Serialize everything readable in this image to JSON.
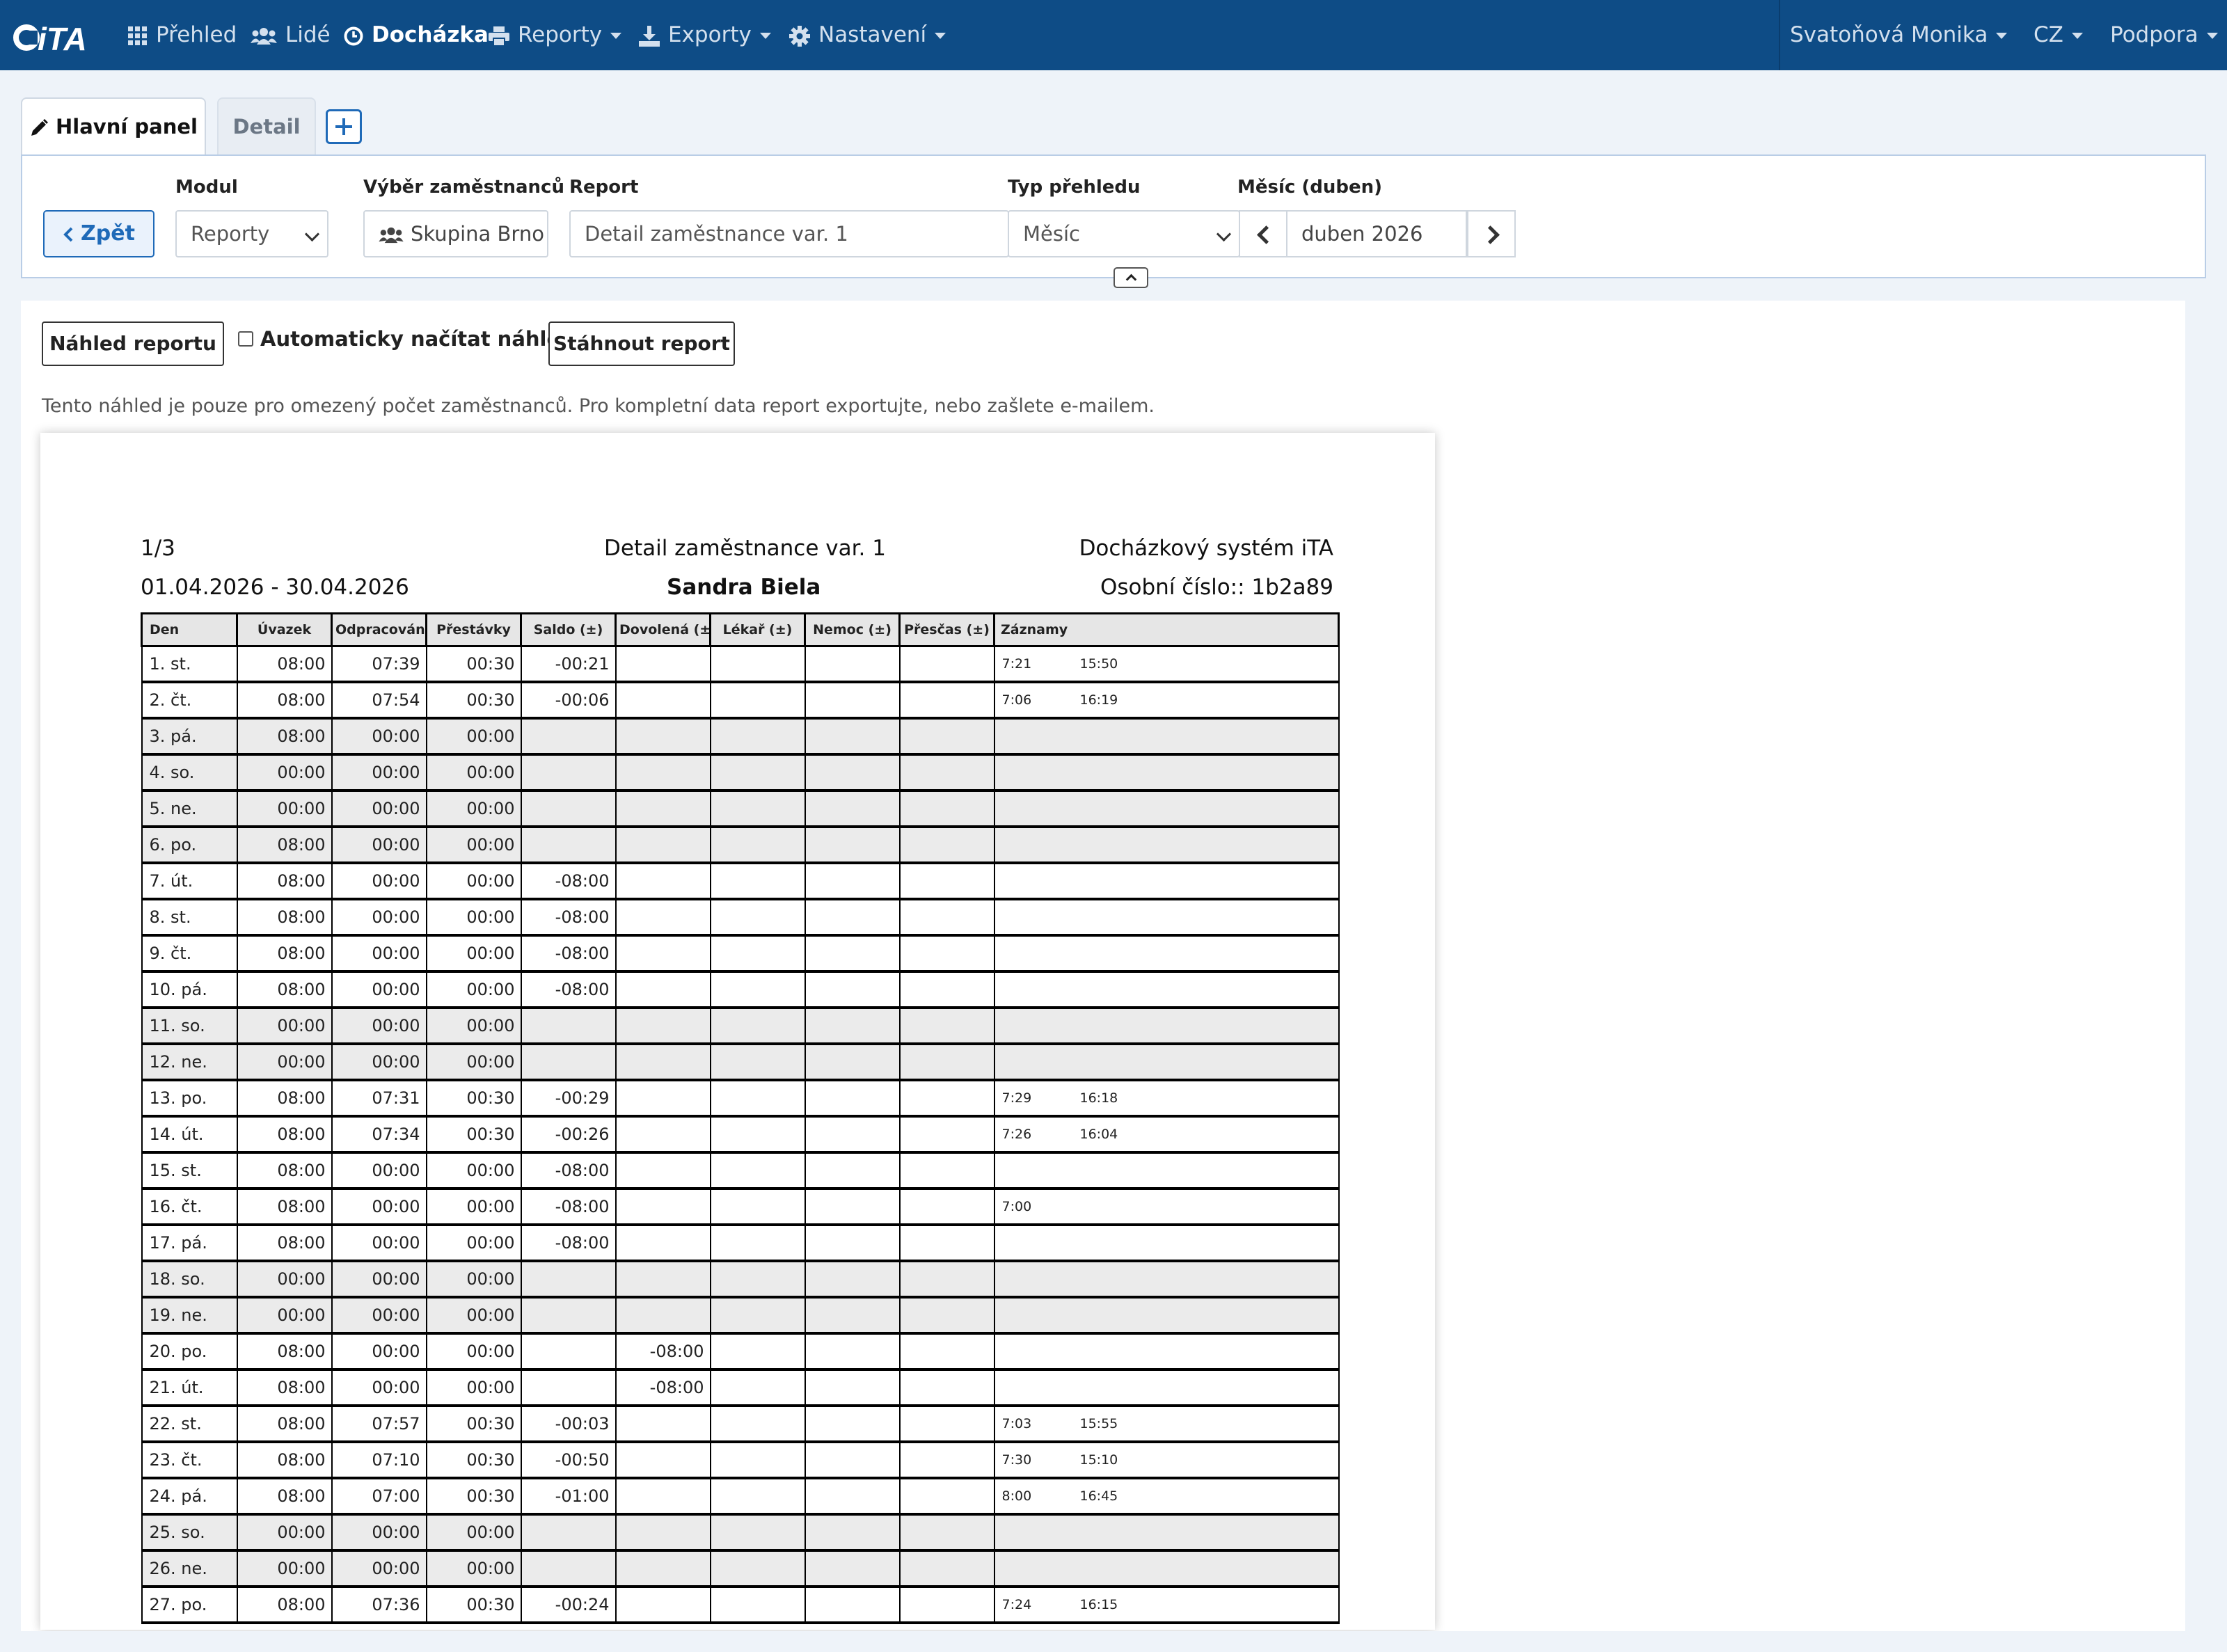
{
  "nav": {
    "logo_text": "iTA",
    "items": [
      {
        "label": "Přehled",
        "icon": "grid-icon"
      },
      {
        "label": "Lidé",
        "icon": "users-icon"
      },
      {
        "label": "Docházka",
        "icon": "clock-icon"
      },
      {
        "label": "Reporty",
        "icon": "print-icon"
      },
      {
        "label": "Exporty",
        "icon": "export-icon"
      },
      {
        "label": "Nastavení",
        "icon": "gear-icon"
      }
    ],
    "user": "Svatoňová Monika",
    "lang": "CZ",
    "support": "Podpora"
  },
  "tabs": {
    "main": "Hlavní panel",
    "detail": "Detail"
  },
  "filters": {
    "back": "Zpět",
    "module_label": "Modul",
    "module_value": "Reporty",
    "employees_label": "Výběr zaměstnanců",
    "employees_value": "Skupina Brno",
    "report_label": "Report",
    "report_value": "Detail zaměstnance var. 1",
    "type_label": "Typ přehledu",
    "type_value": "Měsíc",
    "month_label": "Měsíc (duben)",
    "month_value": "duben 2026"
  },
  "actions": {
    "preview": "Náhled reportu",
    "auto_load": "Automaticky načítat náhled",
    "download": "Stáhnout report",
    "info": "Tento náhled je pouze pro omezený počet zaměstnanců. Pro kompletní data report exportujte, nebo zašlete e-mailem."
  },
  "report": {
    "page": "1/3",
    "title": "Detail zaměstnance var. 1",
    "system": "Docházkový systém iTA",
    "range": "01.04.2026 - 30.04.2026",
    "employee": "Sandra Biela",
    "personal_no": "Osobní číslo:: 1b2a89",
    "columns": [
      "Den",
      "Úvazek",
      "Odpracováno",
      "Přestávky",
      "Saldo (±)",
      "Dovolená (±)",
      "Lékař (±)",
      "Nemoc (±)",
      "Přesčas (±)",
      "Záznamy"
    ],
    "rows": [
      {
        "day": "1. st.",
        "uvazek": "08:00",
        "odprac": "07:39",
        "prest": "00:30",
        "saldo": "-00:21",
        "dovol": "",
        "in": "7:21",
        "out": "15:50",
        "off": false
      },
      {
        "day": "2. čt.",
        "uvazek": "08:00",
        "odprac": "07:54",
        "prest": "00:30",
        "saldo": "-00:06",
        "dovol": "",
        "in": "7:06",
        "out": "16:19",
        "off": false
      },
      {
        "day": "3. pá.",
        "uvazek": "08:00",
        "odprac": "00:00",
        "prest": "00:00",
        "saldo": "",
        "dovol": "",
        "in": "",
        "out": "",
        "off": true
      },
      {
        "day": "4. so.",
        "uvazek": "00:00",
        "odprac": "00:00",
        "prest": "00:00",
        "saldo": "",
        "dovol": "",
        "in": "",
        "out": "",
        "off": true
      },
      {
        "day": "5. ne.",
        "uvazek": "00:00",
        "odprac": "00:00",
        "prest": "00:00",
        "saldo": "",
        "dovol": "",
        "in": "",
        "out": "",
        "off": true
      },
      {
        "day": "6. po.",
        "uvazek": "08:00",
        "odprac": "00:00",
        "prest": "00:00",
        "saldo": "",
        "dovol": "",
        "in": "",
        "out": "",
        "off": true
      },
      {
        "day": "7. út.",
        "uvazek": "08:00",
        "odprac": "00:00",
        "prest": "00:00",
        "saldo": "-08:00",
        "dovol": "",
        "in": "",
        "out": "",
        "off": false
      },
      {
        "day": "8. st.",
        "uvazek": "08:00",
        "odprac": "00:00",
        "prest": "00:00",
        "saldo": "-08:00",
        "dovol": "",
        "in": "",
        "out": "",
        "off": false
      },
      {
        "day": "9. čt.",
        "uvazek": "08:00",
        "odprac": "00:00",
        "prest": "00:00",
        "saldo": "-08:00",
        "dovol": "",
        "in": "",
        "out": "",
        "off": false
      },
      {
        "day": "10. pá.",
        "uvazek": "08:00",
        "odprac": "00:00",
        "prest": "00:00",
        "saldo": "-08:00",
        "dovol": "",
        "in": "",
        "out": "",
        "off": false
      },
      {
        "day": "11. so.",
        "uvazek": "00:00",
        "odprac": "00:00",
        "prest": "00:00",
        "saldo": "",
        "dovol": "",
        "in": "",
        "out": "",
        "off": true
      },
      {
        "day": "12. ne.",
        "uvazek": "00:00",
        "odprac": "00:00",
        "prest": "00:00",
        "saldo": "",
        "dovol": "",
        "in": "",
        "out": "",
        "off": true
      },
      {
        "day": "13. po.",
        "uvazek": "08:00",
        "odprac": "07:31",
        "prest": "00:30",
        "saldo": "-00:29",
        "dovol": "",
        "in": "7:29",
        "out": "16:18",
        "off": false
      },
      {
        "day": "14. út.",
        "uvazek": "08:00",
        "odprac": "07:34",
        "prest": "00:30",
        "saldo": "-00:26",
        "dovol": "",
        "in": "7:26",
        "out": "16:04",
        "off": false
      },
      {
        "day": "15. st.",
        "uvazek": "08:00",
        "odprac": "00:00",
        "prest": "00:00",
        "saldo": "-08:00",
        "dovol": "",
        "in": "",
        "out": "",
        "off": false
      },
      {
        "day": "16. čt.",
        "uvazek": "08:00",
        "odprac": "00:00",
        "prest": "00:00",
        "saldo": "-08:00",
        "dovol": "",
        "in": "7:00",
        "out": "",
        "off": false
      },
      {
        "day": "17. pá.",
        "uvazek": "08:00",
        "odprac": "00:00",
        "prest": "00:00",
        "saldo": "-08:00",
        "dovol": "",
        "in": "",
        "out": "",
        "off": false
      },
      {
        "day": "18. so.",
        "uvazek": "00:00",
        "odprac": "00:00",
        "prest": "00:00",
        "saldo": "",
        "dovol": "",
        "in": "",
        "out": "",
        "off": true
      },
      {
        "day": "19. ne.",
        "uvazek": "00:00",
        "odprac": "00:00",
        "prest": "00:00",
        "saldo": "",
        "dovol": "",
        "in": "",
        "out": "",
        "off": true
      },
      {
        "day": "20. po.",
        "uvazek": "08:00",
        "odprac": "00:00",
        "prest": "00:00",
        "saldo": "",
        "dovol": "-08:00",
        "in": "",
        "out": "",
        "off": false
      },
      {
        "day": "21. út.",
        "uvazek": "08:00",
        "odprac": "00:00",
        "prest": "00:00",
        "saldo": "",
        "dovol": "-08:00",
        "in": "",
        "out": "",
        "off": false
      },
      {
        "day": "22. st.",
        "uvazek": "08:00",
        "odprac": "07:57",
        "prest": "00:30",
        "saldo": "-00:03",
        "dovol": "",
        "in": "7:03",
        "out": "15:55",
        "off": false
      },
      {
        "day": "23. čt.",
        "uvazek": "08:00",
        "odprac": "07:10",
        "prest": "00:30",
        "saldo": "-00:50",
        "dovol": "",
        "in": "7:30",
        "out": "15:10",
        "off": false
      },
      {
        "day": "24. pá.",
        "uvazek": "08:00",
        "odprac": "07:00",
        "prest": "00:30",
        "saldo": "-01:00",
        "dovol": "",
        "in": "8:00",
        "out": "16:45",
        "off": false
      },
      {
        "day": "25. so.",
        "uvazek": "00:00",
        "odprac": "00:00",
        "prest": "00:00",
        "saldo": "",
        "dovol": "",
        "in": "",
        "out": "",
        "off": true
      },
      {
        "day": "26. ne.",
        "uvazek": "00:00",
        "odprac": "00:00",
        "prest": "00:00",
        "saldo": "",
        "dovol": "",
        "in": "",
        "out": "",
        "off": true
      },
      {
        "day": "27. po.",
        "uvazek": "08:00",
        "odprac": "07:36",
        "prest": "00:30",
        "saldo": "-00:24",
        "dovol": "",
        "in": "7:24",
        "out": "16:15",
        "off": false
      }
    ]
  }
}
